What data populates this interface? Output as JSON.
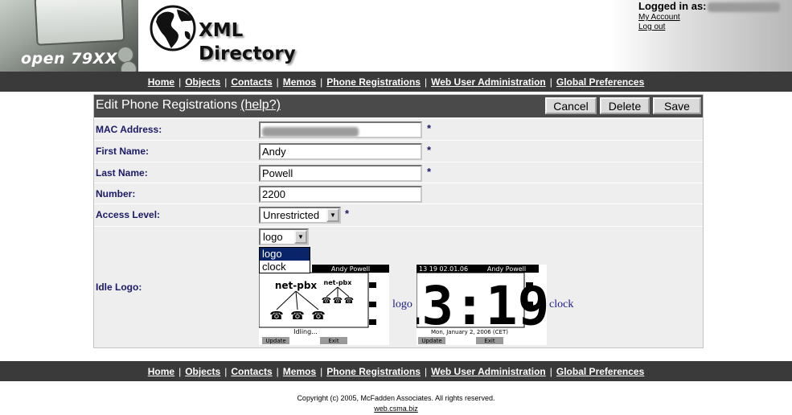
{
  "header": {
    "phone_model": "open 79XX",
    "logo_line1": "XML",
    "logo_line2": "Directory",
    "logged_in_label": "Logged in as:",
    "my_account": "My Account",
    "log_out": "Log out"
  },
  "nav": [
    {
      "label": "Home"
    },
    {
      "label": "Objects"
    },
    {
      "label": "Contacts"
    },
    {
      "label": "Memos"
    },
    {
      "label": "Phone Registrations"
    },
    {
      "label": "Web User Administration"
    },
    {
      "label": "Global Preferences"
    }
  ],
  "panel": {
    "title": "Edit Phone Registrations",
    "help": "(help?)",
    "cancel": "Cancel",
    "delete": "Delete",
    "save": "Save"
  },
  "form": {
    "mac": {
      "label": "MAC Address:",
      "value": ""
    },
    "first_name": {
      "label": "First Name:",
      "value": "Andy"
    },
    "last_name": {
      "label": "Last Name:",
      "value": "Powell"
    },
    "number": {
      "label": "Number:",
      "value": "2200"
    },
    "access_level": {
      "label": "Access Level:",
      "value": "Unrestricted"
    },
    "idle_logo": {
      "label": "Idle Logo:",
      "value": "logo",
      "options": [
        "logo",
        "clock"
      ]
    },
    "required_mark": "*"
  },
  "previews": {
    "logo": {
      "caption": "logo",
      "user": "Andy Powell",
      "brand_big": "net-pbx",
      "brand_small": "net-pbx",
      "status": "Idling...",
      "softkey1": "Update",
      "softkey2": "Exit"
    },
    "clock": {
      "caption": "clock",
      "header_time": "13 19 02.01.06",
      "user": "Andy Powell",
      "big_time": "13:19",
      "date": "Mon, January 2, 2006 (CET)",
      "softkey1": "Update",
      "softkey2": "Exit"
    }
  },
  "footer": {
    "copyright": "Copyright (c) 2005, McFadden Associates. All rights reserved.",
    "link": "web.csma.biz"
  }
}
